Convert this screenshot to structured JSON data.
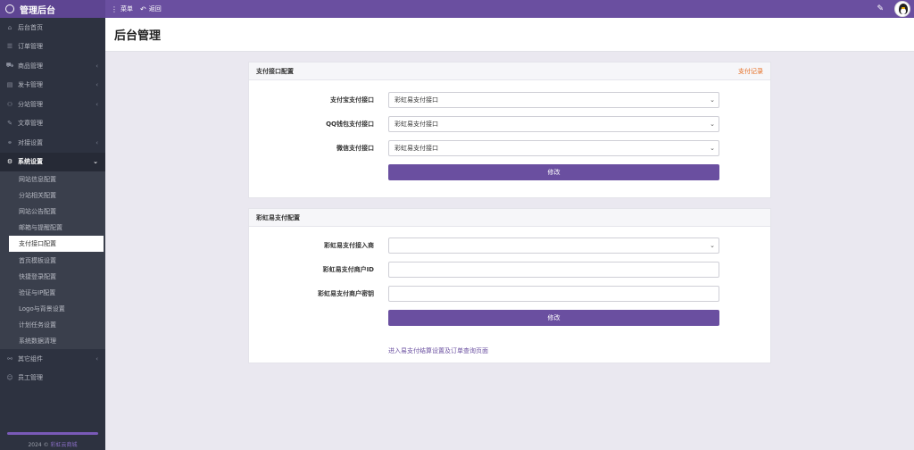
{
  "app": {
    "title": "管理后台"
  },
  "topnav": {
    "menu_label": "菜单",
    "back_label": "返回"
  },
  "sidebar": {
    "items": [
      {
        "label": "后台首页",
        "icon": "home-icon",
        "glyph": "⌂",
        "chevron": false
      },
      {
        "label": "订单管理",
        "icon": "list-icon",
        "glyph": "☰",
        "chevron": false
      },
      {
        "label": "商品管理",
        "icon": "cart-icon",
        "glyph": "⛟",
        "chevron": true
      },
      {
        "label": "发卡管理",
        "icon": "card-icon",
        "glyph": "▤",
        "chevron": true
      },
      {
        "label": "分站管理",
        "icon": "sitemap-icon",
        "glyph": "⚇",
        "chevron": true
      },
      {
        "label": "文章管理",
        "icon": "article-icon",
        "glyph": "✎",
        "chevron": false
      },
      {
        "label": "对接设置",
        "icon": "connect-icon",
        "glyph": "⚭",
        "chevron": true
      },
      {
        "label": "系统设置",
        "icon": "gear-icon",
        "glyph": "⚙",
        "chevron": true
      }
    ],
    "submenu": [
      "网站信息配置",
      "分站相关配置",
      "网站公告配置",
      "邮箱与提醒配置",
      "支付接口配置",
      "首页模板设置",
      "快捷登录配置",
      "验证与IP配置",
      "Logo与背景设置",
      "计划任务设置",
      "系统数据清理"
    ],
    "bottom_items": [
      {
        "label": "其它组件",
        "icon": "components-icon",
        "glyph": "⚯",
        "chevron": true
      },
      {
        "label": "员工管理",
        "icon": "user-icon",
        "glyph": "☺",
        "chevron": false
      }
    ],
    "footer_year": "2024 ©",
    "footer_brand": "彩虹云商城"
  },
  "page": {
    "title": "后台管理"
  },
  "payment_panel": {
    "title": "支付接口配置",
    "link": "支付记录",
    "rows": [
      {
        "label": "支付宝支付接口",
        "value": "彩虹易支付接口"
      },
      {
        "label": "QQ钱包支付接口",
        "value": "彩虹易支付接口"
      },
      {
        "label": "微信支付接口",
        "value": "彩虹易支付接口"
      }
    ],
    "submit": "修改"
  },
  "epay_panel": {
    "title": "彩虹易支付配置",
    "provider_label": "彩虹易支付接入商",
    "provider_value": "",
    "merchant_id_label": "彩虹易支付商户ID",
    "merchant_id_value": "",
    "merchant_key_label": "彩虹易支付商户密钥",
    "merchant_key_value": "",
    "submit": "修改",
    "link": "进入易支付结算设置及订单查询页面"
  },
  "colors": {
    "accent": "#6a4fa0",
    "sidebar": "#2d3240",
    "link_orange": "#e56b1f"
  }
}
